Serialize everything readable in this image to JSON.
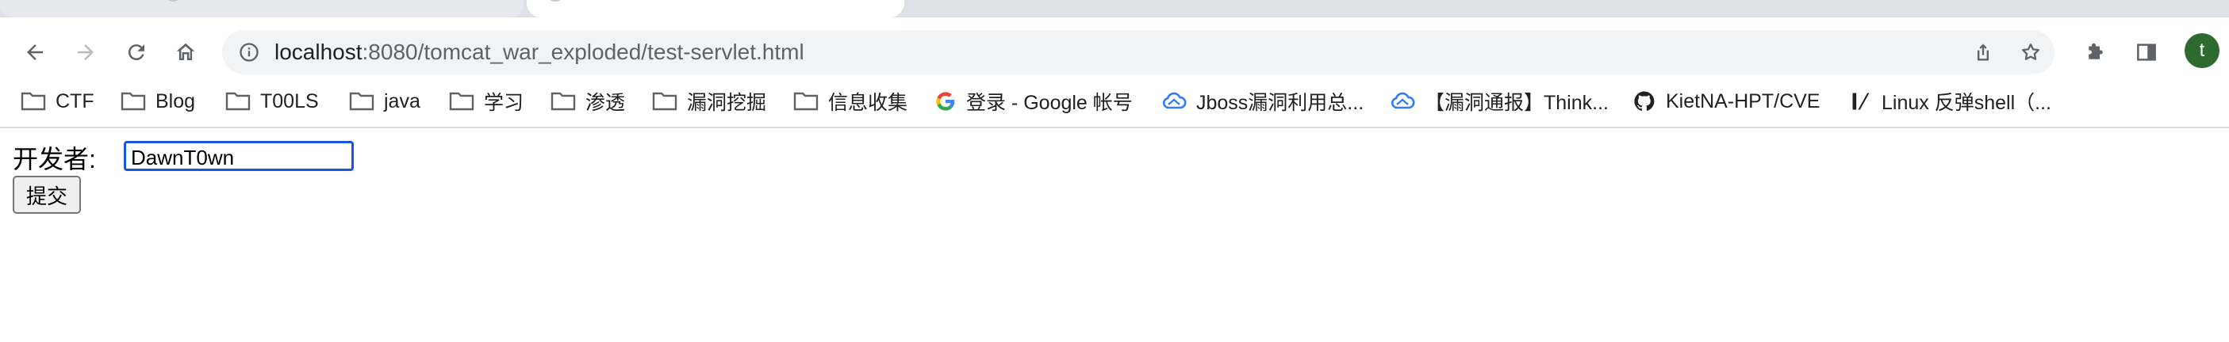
{
  "browser": {
    "url_host": "localhost",
    "url_rest": ":8080/tomcat_war_exploded/test-servlet.html",
    "avatar_letter": "t",
    "colors": {
      "accent": "#1a73e8",
      "avatar_bg": "#2d6a2f",
      "input_focus": "#1a56db"
    }
  },
  "bookmarks": [
    {
      "label": "CTF",
      "icon": "folder-icon"
    },
    {
      "label": "Blog",
      "icon": "folder-icon"
    },
    {
      "label": "T00LS",
      "icon": "folder-icon"
    },
    {
      "label": "java",
      "icon": "folder-icon"
    },
    {
      "label": "学习",
      "icon": "folder-icon"
    },
    {
      "label": "渗透",
      "icon": "folder-icon"
    },
    {
      "label": "漏洞挖掘",
      "icon": "folder-icon"
    },
    {
      "label": "信息收集",
      "icon": "folder-icon"
    },
    {
      "label": "登录 - Google 帐号",
      "icon": "google-icon"
    },
    {
      "label": "Jboss漏洞利用总...",
      "icon": "cloud-icon"
    },
    {
      "label": "【漏洞通报】Think...",
      "icon": "cloud-icon"
    },
    {
      "label": "KietNA-HPT/CVE",
      "icon": "github-icon"
    },
    {
      "label": "Linux 反弹shell（...",
      "icon": "slash-icon"
    }
  ],
  "form": {
    "label": "开发者:",
    "value": "DawnT0wn",
    "submit_label": "提交"
  }
}
